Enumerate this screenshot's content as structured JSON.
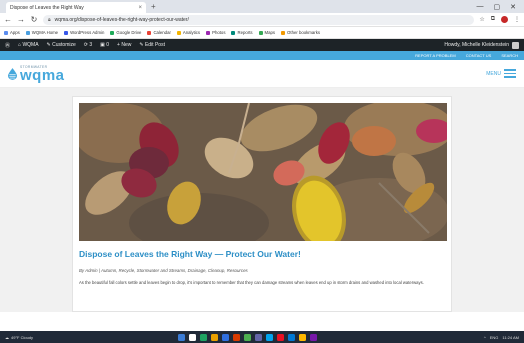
{
  "browser": {
    "tab_title": "Dispose of Leaves the Right Way",
    "tab_close": "×",
    "new_tab": "+",
    "window_controls": [
      "—",
      "▢",
      "✕"
    ],
    "url": "wqma.org/dispose-of-leaves-the-right-way-protect-our-water/",
    "bookmarks": [
      "Apps",
      "WQMA Home",
      "WordPress Admin",
      "Google Drive",
      "Calendar",
      "Analytics",
      "Photos",
      "Reports",
      "Maps",
      "Other bookmarks"
    ],
    "bookmark_colors": [
      "#5b8def",
      "#4a9fe0",
      "#3858e9",
      "#1faa59",
      "#e94235",
      "#f4b400",
      "#9c27b0",
      "#00897b",
      "#34a853",
      "#f29900"
    ]
  },
  "wp_admin": {
    "items": [
      "WQMA",
      "Customize",
      "3",
      "0",
      "+ New",
      "Edit Post"
    ],
    "howdy": "Howdy, Michelle Kleidenstein"
  },
  "site": {
    "top_links": [
      "Report a Problem",
      "Contact Us",
      "Search"
    ],
    "logo_small": "STORMWATER",
    "logo_main": "wqma",
    "menu_label": "MENU"
  },
  "post": {
    "title": "Dispose of Leaves the Right Way — Protect Our Water!",
    "byline": "By Admin  |  Autumn, Recycle, Stormwater and Streams, Drainage, Cleanup, Resources",
    "excerpt": "As the beautiful fall colors settle and leaves begin to drop, it's important to remember that they can damage streams when leaves end up in storm drains and washed into local waterways."
  },
  "taskbar": {
    "weather": "49°F Cloudy",
    "tray": [
      "^",
      "ENG",
      "11:24 AM"
    ],
    "app_colors": [
      "#3a7bd5",
      "#ffffff",
      "#1ea362",
      "#e8a000",
      "#2f6fe0",
      "#d83b01",
      "#4caf50",
      "#6264a7",
      "#00a4ef",
      "#e81123",
      "#0078d4",
      "#ffb900",
      "#7719aa"
    ]
  }
}
